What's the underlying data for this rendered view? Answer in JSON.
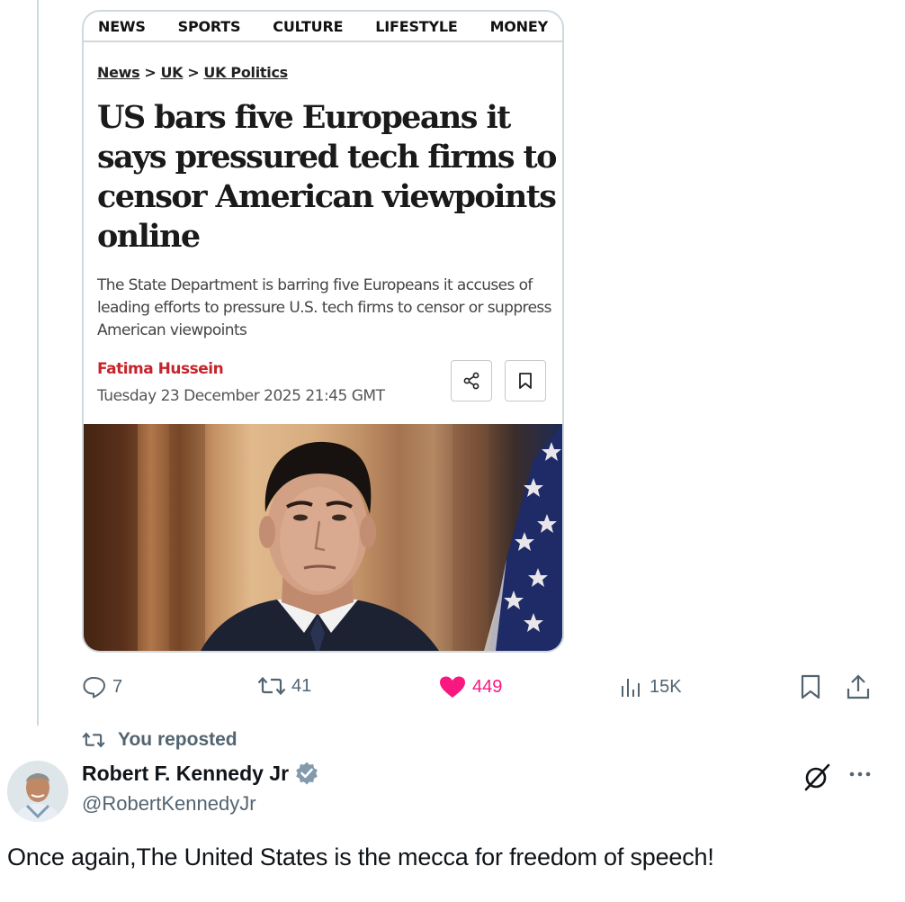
{
  "article": {
    "nav": [
      "NEWS",
      "SPORTS",
      "CULTURE",
      "LIFESTYLE",
      "MONEY"
    ],
    "breadcrumb": [
      "News",
      "UK",
      "UK Politics"
    ],
    "breadcrumb_separator": ">",
    "headline": "US bars five Europeans it says pressured tech firms to censor American viewpoints online",
    "standfirst": "The State Department is barring five Europeans it accuses of leading efforts to pressure U.S. tech firms to censor or suppress American viewpoints",
    "author": "Fatima Hussein",
    "date": "Tuesday 23 December 2025 21:45 GMT",
    "author_color": "#c6242b"
  },
  "quoted_actions": {
    "replies": "7",
    "reposts": "41",
    "likes": "449",
    "views": "15K",
    "liked": true,
    "like_color": "#f91880"
  },
  "repost_banner": "You reposted",
  "post": {
    "display_name": "Robert F. Kennedy Jr",
    "handle": "@RobertKennedyJr",
    "verified_color": "#829aab",
    "text": "Once again,The United States is the mecca for freedom of speech!"
  }
}
